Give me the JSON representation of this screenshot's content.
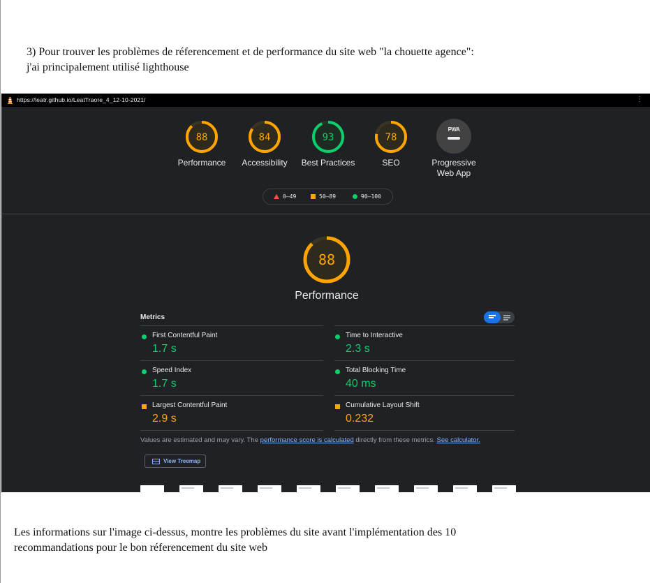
{
  "document": {
    "intro_line1": "3) Pour trouver les problèmes de réferencement et de performance du site web \"la chouette agence\":",
    "intro_line2": "j'ai principalement utilisé lighthouse",
    "outro_line1": "Les informations sur l'image ci-dessus, montre les problèmes du site avant l'implémentation des 10",
    "outro_line2": "recommandations pour le bon réferencement du site web"
  },
  "report": {
    "url": "https://leatr.github.io/LeatTraore_4_12-10-2021/",
    "categories": [
      {
        "score": 88,
        "label": "Performance",
        "color": "#ffa400"
      },
      {
        "score": 84,
        "label": "Accessibility",
        "color": "#ffa400"
      },
      {
        "score": 93,
        "label": "Best Practices",
        "color": "#0cce6b"
      },
      {
        "score": 78,
        "label": "SEO",
        "color": "#ffa400"
      }
    ],
    "pwa": {
      "badge": "PWA",
      "label_line1": "Progressive",
      "label_line2": "Web App"
    },
    "legend": {
      "fail": "0–49",
      "average": "50–89",
      "pass": "90–100"
    },
    "performance": {
      "score": 88,
      "title": "Performance",
      "metrics_title": "Metrics",
      "metrics": [
        {
          "name": "First Contentful Paint",
          "value": "1.7 s",
          "status": "pass"
        },
        {
          "name": "Time to Interactive",
          "value": "2.3 s",
          "status": "pass"
        },
        {
          "name": "Speed Index",
          "value": "1.7 s",
          "status": "pass"
        },
        {
          "name": "Total Blocking Time",
          "value": "40 ms",
          "status": "pass"
        },
        {
          "name": "Largest Contentful Paint",
          "value": "2.9 s",
          "status": "average"
        },
        {
          "name": "Cumulative Layout Shift",
          "value": "0.232",
          "status": "average"
        }
      ],
      "note_prefix": "Values are estimated and may vary. The ",
      "note_link1": "performance score is calculated",
      "note_mid": " directly from these metrics. ",
      "note_link2": "See calculator.",
      "treemap_label": "View Treemap"
    },
    "colors": {
      "pass": "#0cce6b",
      "average": "#ffa400",
      "fail": "#ff4e42"
    }
  }
}
